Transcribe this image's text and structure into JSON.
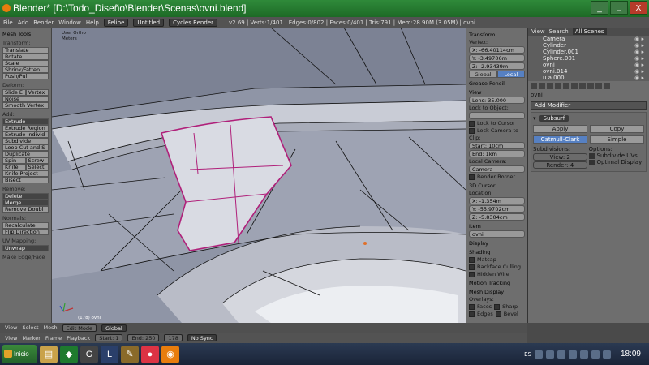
{
  "window": {
    "title": "Blender* [D:\\Todo_Diseño\\Blender\\Scenas\\ovni.blend]",
    "controls": [
      "_",
      "□",
      "X"
    ]
  },
  "menubar": {
    "items": [
      "File",
      "Add",
      "Render",
      "Window",
      "Help"
    ],
    "screen": "Felipe",
    "scene": "Untitled",
    "engine": "Cycles Render",
    "stats": "v2.69 | Verts:1/401 | Edges:0/802 | Faces:0/401 | Tris:791 | Mem:28.90M (3.05M) | ovni"
  },
  "tools": {
    "title": "Mesh Tools",
    "transform_label": "Transform:",
    "transform": [
      "Translate",
      "Rotate",
      "Scale",
      "Shrink/Fatten",
      "Push/Pull"
    ],
    "deform_label": "Deform:",
    "deform_row": [
      "Slide E",
      "Vertex"
    ],
    "deform": [
      "Noise",
      "Smooth Vertex"
    ],
    "add_label": "Add:",
    "extrude": "Extrude",
    "add": [
      "Extrude Region",
      "Extrude Individ",
      "Subdivide",
      "Loop Cut and S",
      "Duplicate"
    ],
    "spin_row": [
      "Spin",
      "Screw"
    ],
    "knife_row": [
      "Knife",
      "Select"
    ],
    "add2": [
      "Knife Project",
      "Bisect"
    ],
    "remove_label": "Remove:",
    "delete": "Delete",
    "merge": "Merge",
    "remove_doubles": "Remove Doubl",
    "normals_label": "Normals:",
    "normals": [
      "Recalculate",
      "Flip Direction"
    ],
    "uv_label": "UV Mapping:",
    "unwrap": "Unwrap",
    "footer": "Make Edge/Face"
  },
  "viewport": {
    "view_label": "User Ortho",
    "units": "Meters",
    "object_label": "(178) ovni"
  },
  "npanel": {
    "transform_header": "Transform",
    "vertex_label": "Vertex:",
    "x": "X: -66.40114cm",
    "y": "Y: -3.49706m",
    "z": "Z: -2.93439m",
    "space": [
      "Global",
      "Local"
    ],
    "grease_header": "Grease Pencil",
    "view_header": "View",
    "lens": "Lens: 35.000",
    "lock_object_label": "Lock to Object:",
    "lock_cursor": "Lock to Cursor",
    "lock_camera": "Lock Camera to",
    "clip_label": "Clip:",
    "clip_start": "Start: 10cm",
    "clip_end": "End: 1km",
    "local_camera_label": "Local Camera:",
    "local_camera": "Camera",
    "render_border": "Render Border",
    "cursor_header": "3D Cursor",
    "location_label": "Location:",
    "cx": "X: -1.354m",
    "cy": "Y: -55.9702cm",
    "cz": "Z: -5.8304cm",
    "item_header": "Item",
    "item_name": "ovni",
    "display_header": "Display",
    "shading_header": "Shading",
    "matcap": "Matcap",
    "backface": "Backface Culling",
    "hidden_wire": "Hidden Wire",
    "motion_header": "Motion Tracking",
    "mesh_display_header": "Mesh Display",
    "overlays_label": "Overlays:",
    "faces": "Faces",
    "sharp": "Sharp",
    "edges": "Edges",
    "bevel": "Bevel"
  },
  "outliner": {
    "view": "View",
    "search": "Search",
    "scope": "All Scenes",
    "items": [
      "Camera",
      "Cylinder",
      "Cylinder.001",
      "Sphere.001",
      "ovni",
      "ovni.014",
      "u.a.000"
    ]
  },
  "props": {
    "breadcrumb": "ovni",
    "add_modifier": "Add Modifier",
    "modifier_name": "Subsurf",
    "apply": "Apply",
    "copy": "Copy",
    "algo": [
      "Catmull-Clark",
      "Simple"
    ],
    "subdivisions_label": "Subdivisions:",
    "view_level": "View: 2",
    "render_level": "Render: 4",
    "options_label": "Options:",
    "subdivide_uvs": "Subdivide UVs",
    "optimal_display": "Optimal Display"
  },
  "timeline": {
    "items": [
      "View",
      "Marker",
      "Frame",
      "Playback"
    ],
    "start": "Start: 1",
    "end": "End: 250",
    "current": "178",
    "sync": "No Sync"
  },
  "header3d": {
    "items": [
      "View",
      "Select",
      "Mesh"
    ],
    "mode": "Edit Mode",
    "orientation": "Global"
  },
  "taskbar": {
    "start": "Inicio",
    "lang": "ES",
    "time": "18:09"
  }
}
